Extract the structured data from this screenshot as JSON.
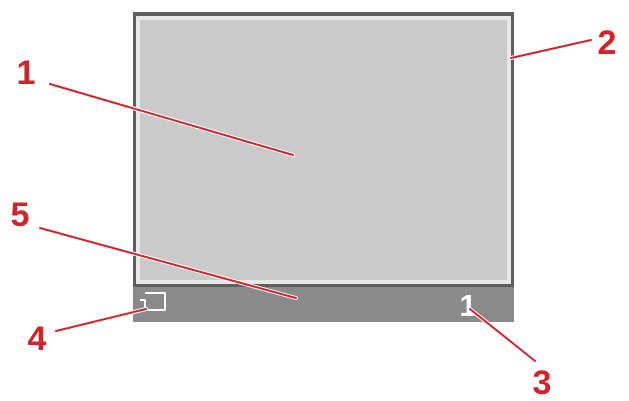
{
  "screen": {
    "page_number": "1",
    "frame_color": "#5f5f5f",
    "inner_frame_color": "#e8e8e8",
    "display_color": "#cacaca",
    "status_bar_color": "#8a8a8a",
    "page_number_color": "#ffffff",
    "status_icon": "sd-card-icon"
  },
  "callouts": [
    {
      "label": "1"
    },
    {
      "label": "2"
    },
    {
      "label": "3"
    },
    {
      "label": "4"
    },
    {
      "label": "5"
    }
  ],
  "callout_color": "#d2232a"
}
